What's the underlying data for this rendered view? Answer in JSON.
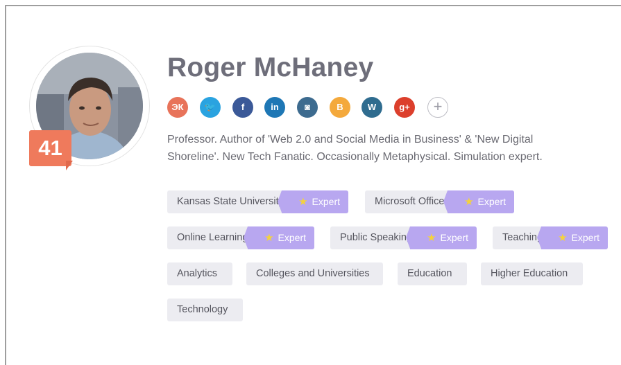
{
  "profile": {
    "name": "Roger McHaney",
    "score": "41",
    "bio_line1": "Professor. Author of 'Web 2.0 and Social Media in Business' & 'New Digital",
    "bio_line2": "Shoreline'. New Tech Fanatic. Occasionally Metaphysical. Simulation expert."
  },
  "socials": [
    {
      "name": "xing-icon",
      "glyph": "ЭК",
      "color": "#e8735a"
    },
    {
      "name": "twitter-icon",
      "glyph": "🐦",
      "color": "#2aa3e0"
    },
    {
      "name": "facebook-icon",
      "glyph": "f",
      "color": "#3b5998"
    },
    {
      "name": "linkedin-icon",
      "glyph": "in",
      "color": "#1e77b5"
    },
    {
      "name": "instagram-icon",
      "glyph": "◙",
      "color": "#3d6b8f"
    },
    {
      "name": "blogger-icon",
      "glyph": "B",
      "color": "#f4a93c"
    },
    {
      "name": "wordpress-icon",
      "glyph": "W",
      "color": "#2f6c8f"
    },
    {
      "name": "google-plus-icon",
      "glyph": "g+",
      "color": "#dc3f2c"
    },
    {
      "name": "add-icon",
      "glyph": "+",
      "color": "#ffffff"
    }
  ],
  "expert_label": "Expert",
  "skills": [
    {
      "label": "Kansas State University",
      "expert": true
    },
    {
      "label": "Microsoft Office",
      "expert": true
    },
    {
      "label": "Online Learning",
      "expert": true
    },
    {
      "label": "Public Speaking",
      "expert": true
    },
    {
      "label": "Teaching",
      "expert": true
    },
    {
      "label": "Analytics",
      "expert": false
    },
    {
      "label": "Colleges and Universities",
      "expert": false
    },
    {
      "label": "Education",
      "expert": false
    },
    {
      "label": "Higher Education",
      "expert": false
    },
    {
      "label": "Technology",
      "expert": false
    }
  ]
}
